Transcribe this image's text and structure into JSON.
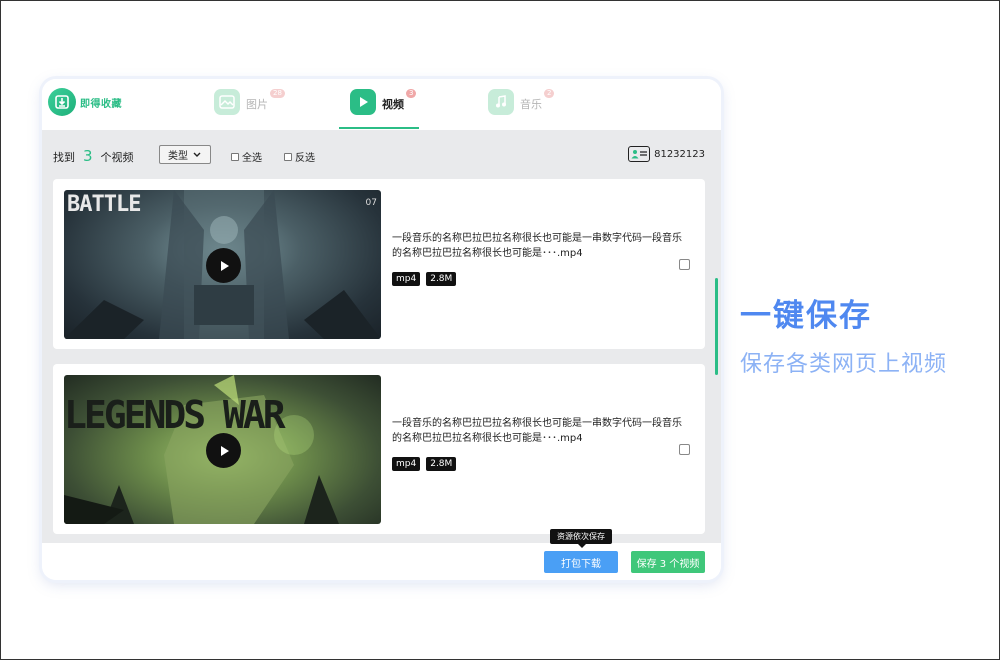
{
  "app": {
    "logo_text": "即得收藏"
  },
  "tabs": [
    {
      "label": "图片",
      "badge": "28"
    },
    {
      "label": "视频",
      "badge": "3"
    },
    {
      "label": "音乐",
      "badge": "2"
    }
  ],
  "toolbar": {
    "found_prefix": "找到",
    "found_count": "3",
    "found_suffix": "个视频",
    "type_label": "类型",
    "select_all": "全选",
    "invert_select": "反选",
    "user_id": "81232123"
  },
  "videos": [
    {
      "thumb_text": "BATTLE",
      "thumb_tag": "07",
      "title": "一段音乐的名称巴拉巴拉名称很长也可能是一串数字代码一段音乐的名称巴拉巴拉名称很长也可能是･･･.mp4",
      "format": "mp4",
      "size": "2.8M"
    },
    {
      "thumb_text": "LEGENDS WAR",
      "title": "一段音乐的名称巴拉巴拉名称很长也可能是一串数字代码一段音乐的名称巴拉巴拉名称很长也可能是･･･.mp4",
      "format": "mp4",
      "size": "2.8M"
    }
  ],
  "footer": {
    "tooltip": "资源依次保存",
    "pack_download": "打包下载",
    "save_videos": "保存 3 个视频"
  },
  "promo": {
    "title": "一键保存",
    "subtitle": "保存各类网页上视频"
  },
  "colors": {
    "accent_green": "#2bbd86",
    "accent_blue": "#4f88f0",
    "button_blue": "#4a9ff5",
    "button_green": "#3fc77a",
    "badge_red": "#f0a8a8"
  }
}
